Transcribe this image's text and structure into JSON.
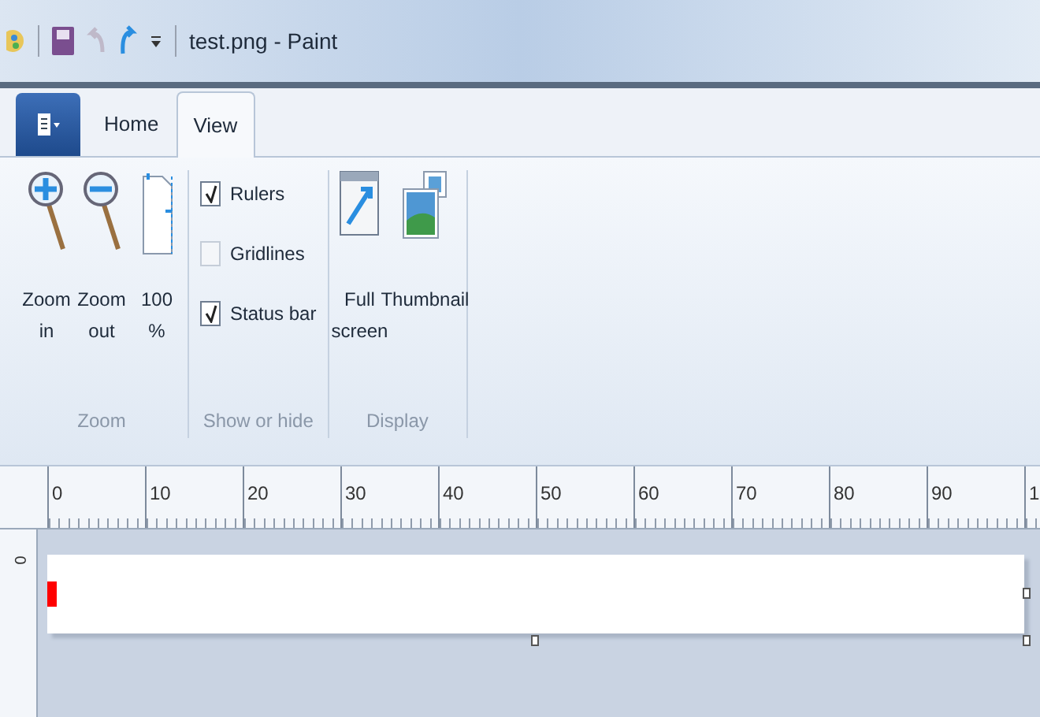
{
  "window": {
    "title": "test.png - Paint"
  },
  "tabs": [
    {
      "label": "Home",
      "selected": false
    },
    {
      "label": "View",
      "selected": true
    }
  ],
  "ribbon": {
    "groups": [
      {
        "label": "Zoom",
        "items": [
          {
            "kind": "zoom-in",
            "label": "Zoom in"
          },
          {
            "kind": "zoom-out",
            "label": "Zoom out"
          },
          {
            "kind": "actual-size",
            "label": "100 %"
          }
        ]
      },
      {
        "label": "Show or hide",
        "items": [
          {
            "kind": "checkbox",
            "label": "Rulers",
            "checked": true
          },
          {
            "kind": "checkbox",
            "label": "Gridlines",
            "checked": false
          },
          {
            "kind": "checkbox",
            "label": "Status bar",
            "checked": true
          }
        ]
      },
      {
        "label": "Display",
        "items": [
          {
            "kind": "full-screen",
            "label": "Full screen"
          },
          {
            "kind": "thumbnail",
            "label": "Thumbnail"
          }
        ]
      }
    ]
  },
  "horizontal_ruler": [
    "0",
    "10",
    "20",
    "30",
    "40",
    "50",
    "60",
    "70",
    "80",
    "90",
    "1"
  ],
  "vertical_ruler": [
    "0"
  ]
}
